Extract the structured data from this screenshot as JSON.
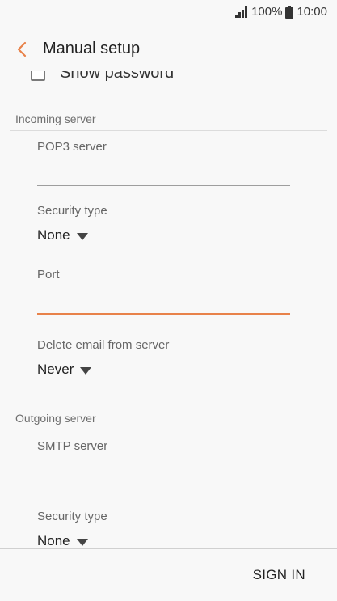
{
  "status_bar": {
    "battery_percent": "100%",
    "time": "10:00"
  },
  "header": {
    "title": "Manual setup"
  },
  "show_password": {
    "label": "Show password",
    "checked": false
  },
  "incoming": {
    "section_title": "Incoming server",
    "server_label": "POP3 server",
    "server_value": "",
    "security_label": "Security type",
    "security_value": "None",
    "port_label": "Port",
    "port_value": "",
    "delete_label": "Delete email from server",
    "delete_value": "Never"
  },
  "outgoing": {
    "section_title": "Outgoing server",
    "server_label": "SMTP server",
    "server_value": "",
    "security_label": "Security type",
    "security_value": "None"
  },
  "footer": {
    "sign_in_label": "SIGN IN"
  },
  "colors": {
    "accent": "#e8824a"
  }
}
